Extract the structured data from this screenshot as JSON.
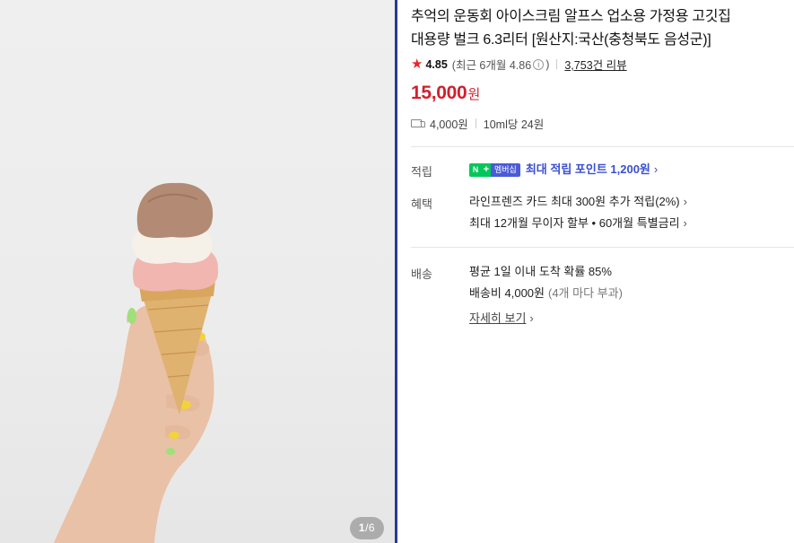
{
  "gallery": {
    "counter_current": "1",
    "counter_total": "6",
    "colors": {
      "background": "#ececec",
      "scoop_chocolate": "#b38b74",
      "scoop_vanilla": "#f6f1e8",
      "scoop_strawberry": "#f2b6b1",
      "cone": "#e0b270",
      "nails": "#f4d23a"
    }
  },
  "product": {
    "title_line1": "추억의 운동회 아이스크림 알프스 업소용 가정용 고깃집",
    "title_line2": "대용량 벌크 6.3리터 [원산지:국산(충청북도 음성군)]",
    "rating": {
      "score": "4.85",
      "recent_label": "(최근 6개월 4.86",
      "recent_close": ")",
      "reviews": "3,753건 리뷰"
    },
    "price": {
      "amount": "15,000",
      "unit": "원",
      "color": "#d21f2d"
    },
    "shipping_summary": {
      "fee": "4,000원",
      "unit_price": "10ml당 24원"
    }
  },
  "details": {
    "points": {
      "label": "적립",
      "badge_n": "N",
      "badge_plus": "+",
      "badge_membership": "멤버십",
      "text": "최대 적립 포인트 1,200원",
      "color": "#3a4fd0"
    },
    "benefits": {
      "label": "혜택",
      "line1": "라인프렌즈 카드 최대 300원 추가 적립(2%)",
      "line2": "최대 12개월 무이자 할부 • 60개월 특별금리"
    },
    "delivery": {
      "label": "배송",
      "line1": "평균 1일 이내 도착 확률 85%",
      "fee_text": "배송비 4,000원",
      "fee_note": "(4개 마다 부과)",
      "detail_link": "자세히 보기"
    }
  }
}
